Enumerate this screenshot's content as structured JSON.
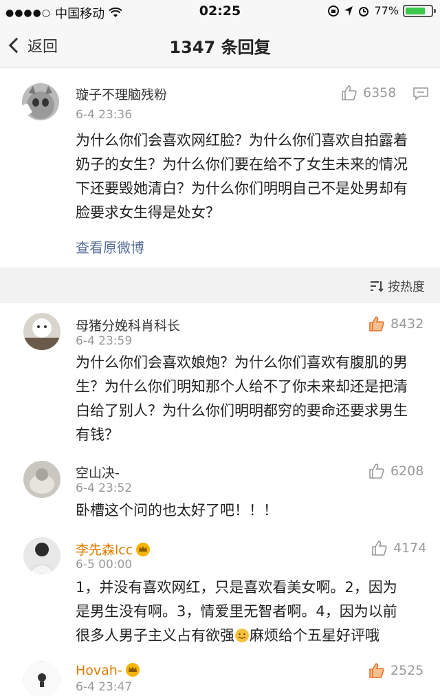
{
  "status_bar": {
    "carrier": "中国移动",
    "time": "02:25",
    "battery": "77%",
    "battery_level": 0.77
  },
  "nav": {
    "back_label": "返回",
    "title": "1347 条回复"
  },
  "main_post": {
    "author": "璇子不理脑残粉",
    "time": "6-4 23:36",
    "likes": "6358",
    "text": "为什么你们会喜欢网红脸？为什么你们喜欢自拍露着奶子的女生？为什么你们要在给不了女生未来的情况下还要毁她清白？为什么你们明明自己不是处男却有脸要求女生得是处女？",
    "view_original": "查看原微博"
  },
  "sort": {
    "label": "按热度"
  },
  "replies": [
    {
      "author": "母猪分娩科肖科长",
      "time": "6-4 23:59",
      "likes": "8432",
      "text": "为什么你们会喜欢娘炮？为什么你们喜欢有腹肌的男生？为什么你们明知那个人给不了你未来却还是把清白给了别人？为什么你们明明都穷的要命还要求男生有钱？"
    },
    {
      "author": "空山决-",
      "time": "6-4 23:52",
      "likes": "6208",
      "text": "卧槽这个问的也太好了吧！！！"
    },
    {
      "author": "李先森lcc",
      "time": "6-5 00:00",
      "likes": "4174",
      "text": "1，并没有喜欢网红，只是喜欢看美女啊。2，因为是男生没有啊。3，情爱里无智者啊。4，因为以前很多人男子主义占有欲强",
      "text_after_emoji": "麻烦给个五星好评哦"
    },
    {
      "author": "Hovah-",
      "time": "6-4 23:47",
      "likes": "2525"
    }
  ]
}
